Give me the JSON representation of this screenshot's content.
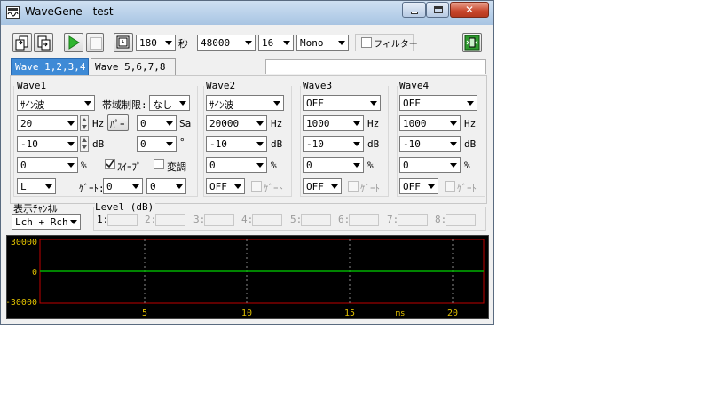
{
  "window": {
    "title": "WaveGene - test"
  },
  "toolbar": {
    "duration_value": "180",
    "duration_unit": "秒",
    "sample_rate": "48000",
    "bit_depth": "16",
    "channels": "Mono",
    "filter_label": "フィルター"
  },
  "tabs": [
    {
      "label": "Wave 1,2,3,4",
      "active": true
    },
    {
      "label": "Wave 5,6,7,8",
      "active": false
    }
  ],
  "wave1": {
    "title": "Wave1",
    "waveform": "ｻｲﾝ波",
    "band_limit_label": "帯域制限:",
    "band_limit": "なし",
    "frequency": "20",
    "freq_unit": "Hz",
    "param_button": "ﾊﾟｰ",
    "sa_value": "0",
    "sa_unit": "Sa",
    "level": "-10",
    "level_unit": "dB",
    "phase": "0",
    "phase_unit": "°",
    "offset": "0",
    "offset_unit": "%",
    "sweep_label": "ｽｲｰﾌﾟ",
    "sweep_checked": true,
    "modulation_label": "変調",
    "modulation_checked": false,
    "channel": "L",
    "gate_label": "ｹﾞｰﾄ:",
    "gate_a": "0",
    "gate_b": "0"
  },
  "waves": [
    {
      "title": "Wave2",
      "waveform": "ｻｲﾝ波",
      "frequency": "20000",
      "level": "-10",
      "offset": "0",
      "gate_select": "OFF"
    },
    {
      "title": "Wave3",
      "waveform": "OFF",
      "frequency": "1000",
      "level": "-10",
      "offset": "0",
      "gate_select": "OFF"
    },
    {
      "title": "Wave4",
      "waveform": "OFF",
      "frequency": "1000",
      "level": "-10",
      "offset": "0",
      "gate_select": "OFF"
    }
  ],
  "units": {
    "hz": "Hz",
    "db": "dB",
    "pct": "%",
    "gate": "ｹﾞｰﾄ"
  },
  "display": {
    "label": "表示ﾁｬﾝﾈﾙ",
    "channel": "Lch + Rch"
  },
  "level": {
    "label": "Level (dB)",
    "slots": [
      "1:",
      "2:",
      "3:",
      "4:",
      "5:",
      "6:",
      "7:",
      "8:"
    ]
  },
  "scope": {
    "y_labels": [
      "30000",
      "0",
      "-30000"
    ],
    "x_labels": [
      "5",
      "10",
      "15",
      "20"
    ],
    "x_unit": "ms",
    "colors": {
      "background": "#000000",
      "frame": "#c00000",
      "grid": "#8a8a8a",
      "signal": "#00b000",
      "labels": "#e0c000"
    }
  }
}
